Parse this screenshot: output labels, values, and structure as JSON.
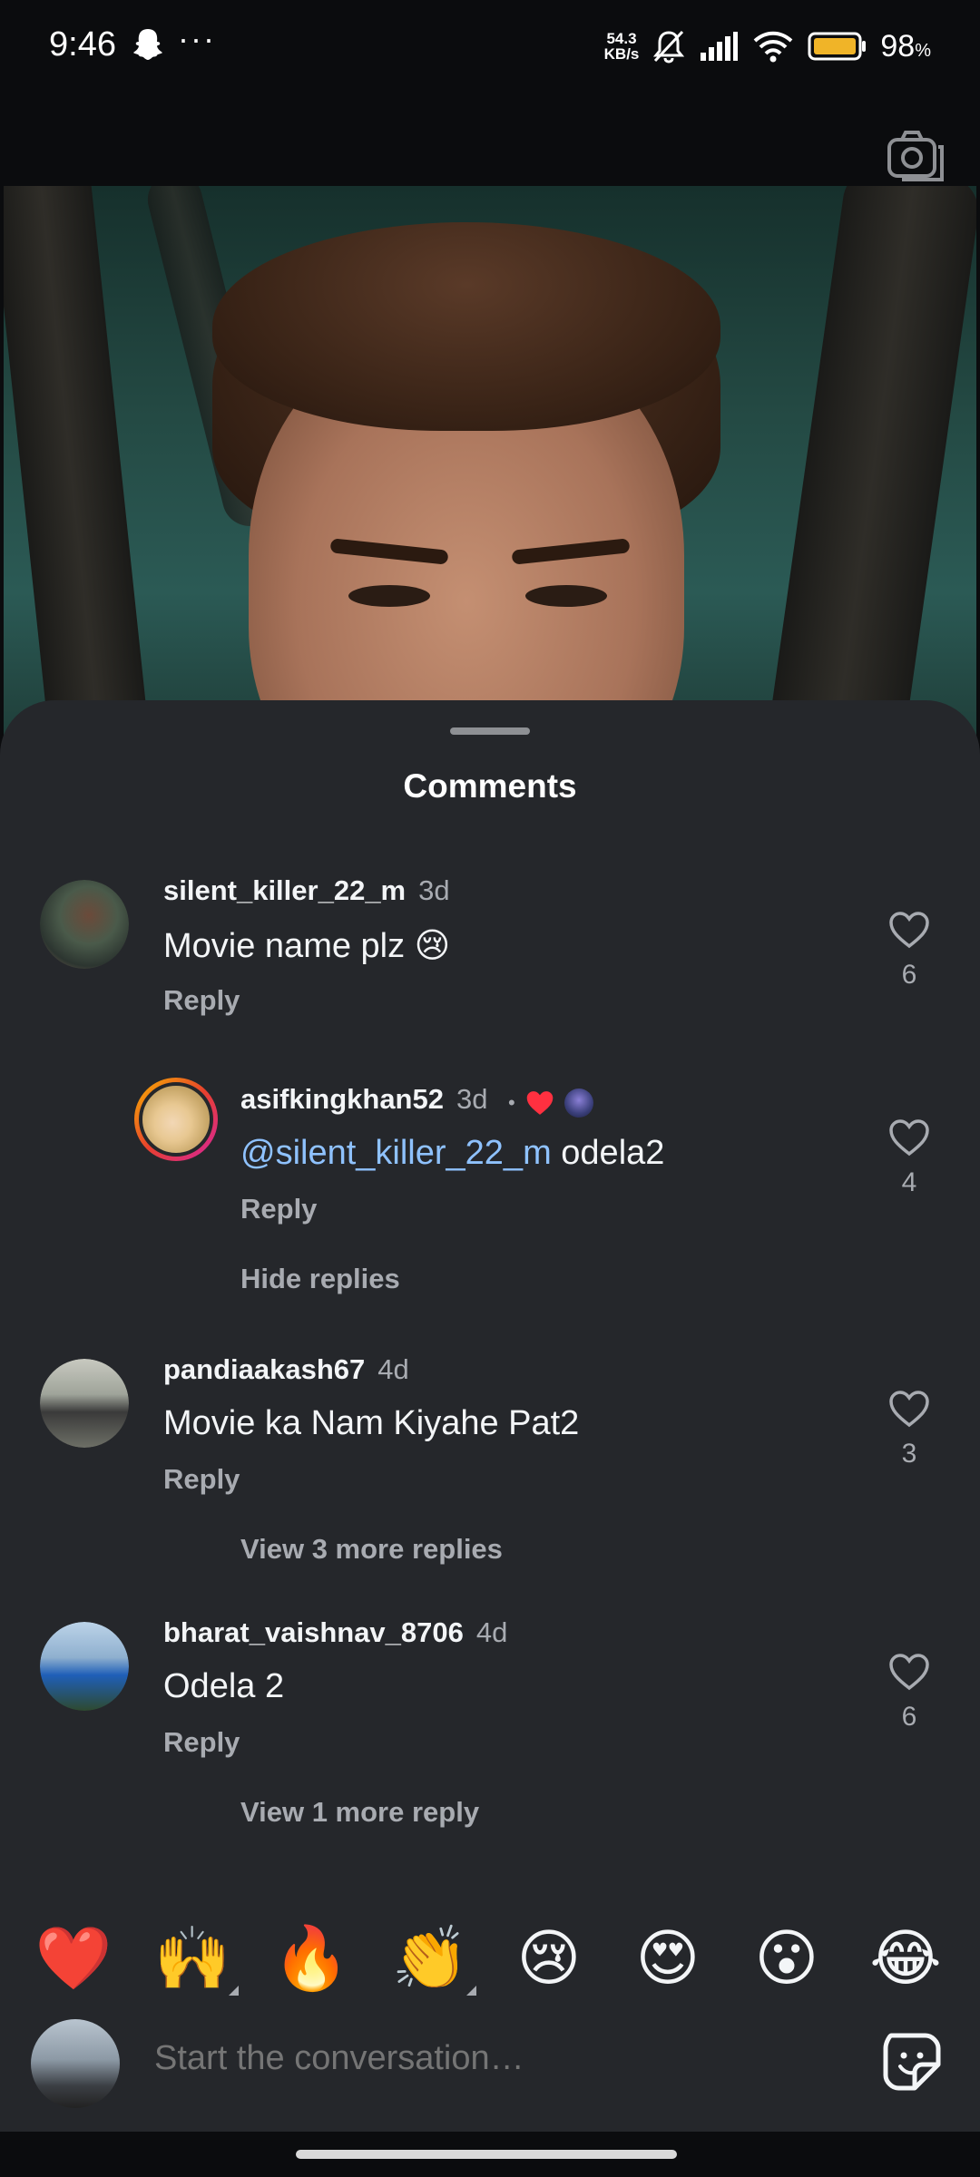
{
  "status_bar": {
    "time": "9:46",
    "dots": "···",
    "speed_top": "54.3",
    "speed_bottom": "KB/s",
    "battery_percent": "98",
    "battery_unit": "%",
    "icons": [
      "snapchat-ghost-icon",
      "mute-bell-icon",
      "signal-icon",
      "wifi-icon",
      "battery-icon"
    ]
  },
  "sheet": {
    "title": "Comments"
  },
  "comments": [
    {
      "username": "silent_killer_22_m",
      "time": "3d",
      "text": "Movie name plz 😢",
      "reply_label": "Reply",
      "likes": "6"
    },
    {
      "username": "asifkingkhan52",
      "time": "3d",
      "dot": "•",
      "mention": "@silent_killer_22_m",
      "text": " odela2",
      "reply_label": "Reply",
      "likes": "4",
      "hide_replies_label": "Hide replies"
    },
    {
      "username": "pandiaakash67",
      "time": "4d",
      "text": "Movie ka Nam Kiyahe Pat2",
      "reply_label": "Reply",
      "likes": "3",
      "view_more_label": "View 3 more replies"
    },
    {
      "username": "bharat_vaishnav_8706",
      "time": "4d",
      "text": "Odela 2",
      "reply_label": "Reply",
      "likes": "6",
      "view_more_label": "View 1 more reply"
    }
  ],
  "emoji_bar": [
    "❤️",
    "🙌",
    "🔥",
    "👏",
    "😢",
    "😍",
    "😮",
    "😂"
  ],
  "composer": {
    "placeholder": "Start the conversation…"
  },
  "colors": {
    "sheet_bg": "#25272b",
    "mention": "#8fc2ff",
    "secondary_text": "#a8abb1",
    "story_ring_start": "#f7b300",
    "story_ring_end": "#d6249f"
  }
}
